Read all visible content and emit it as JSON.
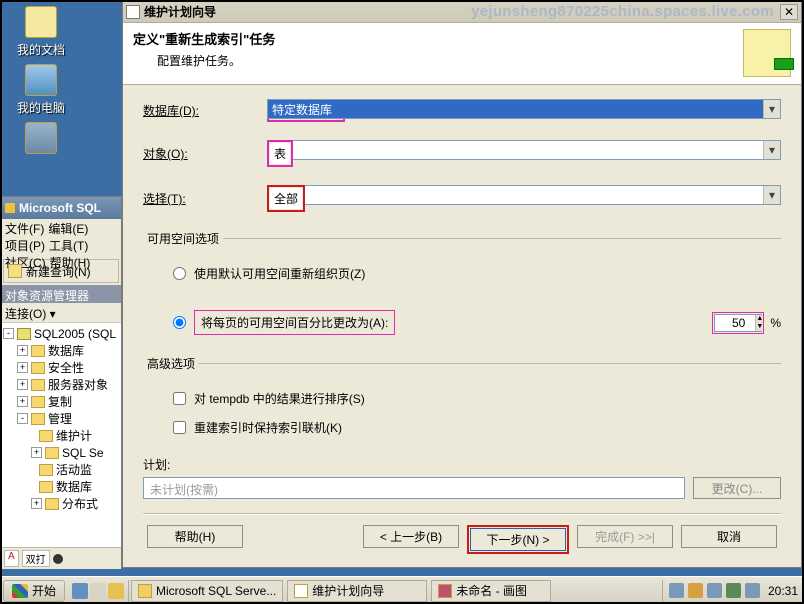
{
  "desktop": {
    "docs": "我的文档",
    "computer": "我的电脑"
  },
  "ssms": {
    "title": "Microsoft SQL",
    "menu": [
      "文件(F)",
      "编辑(E)",
      "项目(P)",
      "工具(T)",
      "社区(C)",
      "帮助(H)"
    ],
    "new_query": "新建查询(N)",
    "panel": "对象资源管理器",
    "connect": "连接(O) ▾",
    "tree": {
      "root": "SQL2005 (SQL",
      "nodes": [
        "数据库",
        "安全性",
        "服务器对象",
        "复制",
        "管理"
      ],
      "mgmt": [
        "维护计",
        "SQL Se",
        "活动监",
        "数据库",
        "分布式"
      ]
    },
    "bottom_tabs": [
      "A",
      "双打"
    ]
  },
  "wizard": {
    "title": "维护计划向导",
    "url_overlay": "yejunsheng870225china.spaces.live.com",
    "header": {
      "title": "定义\"重新生成索引\"任务",
      "subtitle": "配置维护任务。"
    },
    "rows": {
      "database_label": "数据库(D):",
      "database_value": "特定数据库",
      "object_label": "对象(O):",
      "object_value": "表",
      "select_label": "选择(T):",
      "select_value": "全部"
    },
    "freespace": {
      "legend": "可用空间选项",
      "opt1": "使用默认可用空间重新组织页(Z)",
      "opt2": "将每页的可用空间百分比更改为(A):",
      "percent_value": "50",
      "percent_suffix": "%"
    },
    "advanced": {
      "legend": "高级选项",
      "chk1": "对 tempdb 中的结果进行排序(S)",
      "chk2": "重建索引时保持索引联机(K)"
    },
    "plan": {
      "label": "计划:",
      "placeholder": "未计划(按需)",
      "change": "更改(C)..."
    },
    "buttons": {
      "help": "帮助(H)",
      "back": "< 上一步(B)",
      "next": "下一步(N) >",
      "finish": "完成(F) >>|",
      "cancel": "取消"
    }
  },
  "taskbar": {
    "start": "开始",
    "tasks": [
      "Microsoft SQL Serve...",
      "维护计划向导",
      "未命名 - 画图"
    ],
    "clock": "20:31"
  }
}
